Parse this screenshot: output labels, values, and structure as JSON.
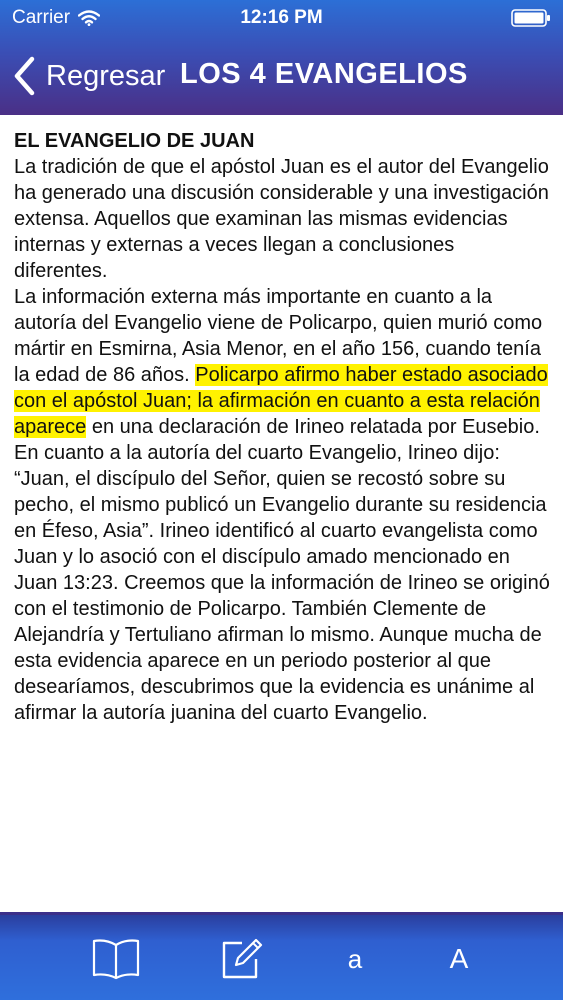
{
  "status": {
    "carrier": "Carrier",
    "time": "12:16 PM",
    "icons": [
      "wifi-icon",
      "battery-icon"
    ]
  },
  "nav": {
    "back_label": "Regresar",
    "title": "LOS 4 EVANGELIOS",
    "icon": "chevron-left-icon"
  },
  "article": {
    "title": "EL EVANGELIO DE JUAN",
    "p1": "La tradición de que el apóstol Juan es el autor del Evangelio ha generado una discusión considerable y una investigación extensa. Aquellos que examinan las mismas evidencias internas y externas a veces llegan a conclusiones diferentes.",
    "p2_before": "La información externa más importante en cuanto a la autoría del Evangelio viene de Policarpo,  quien murió como mártir en Esmirna, Asia Menor, en el año 156, cuando tenía la edad de 86 años. ",
    "p2_highlight": "Policarpo afirmo haber estado asociado con el apóstol Juan; la afirmación en cuanto a esta relación aparece",
    "p2_after": " en una declaración de Irineo relatada por Eusebio. En cuanto a la autoría del  cuarto Evangelio, Irineo dijo: “Juan, el discípulo del Señor, quien se recostó sobre su pecho, el mismo publicó un Evangelio durante su residencia en Éfeso, Asia”. Irineo identificó al cuarto evangelista como Juan y lo asoció con el discípulo amado mencionado en Juan 13:23. Creemos que la información de Irineo se originó con el testimonio de Policarpo. También Clemente de Alejandría y Tertuliano afirman lo mismo. Aunque mucha de esta evidencia aparece en un periodo posterior al que desearíamos, descubrimos que la evidencia es unánime al afirmar la autoría juanina del cuarto Evangelio.",
    "highlight_color": "#fff200"
  },
  "toolbar": {
    "book_icon": "book-icon",
    "edit_icon": "edit-note-icon",
    "font_small_label": "a",
    "font_large_label": "A"
  },
  "colors": {
    "header_top": "#2c6fd6",
    "header_bottom": "#4a2f86",
    "toolbar": "#2f6fdc"
  }
}
